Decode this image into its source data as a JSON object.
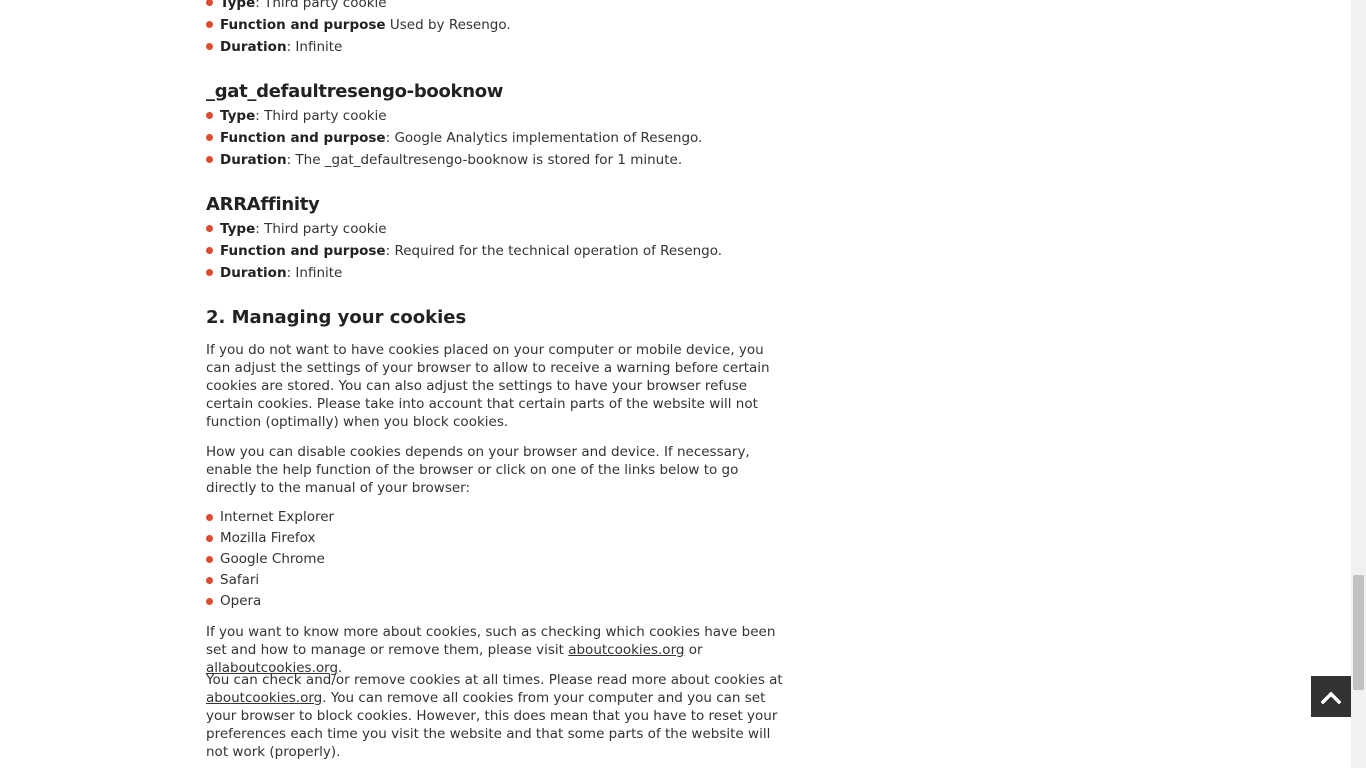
{
  "top_partial": {
    "items": [
      {
        "label": "Type",
        "sep": ": ",
        "text": "Third party cookie"
      },
      {
        "label": "Function and purpose",
        "sep": " ",
        "text": "Used by Resengo."
      },
      {
        "label": "Duration",
        "sep": ": ",
        "text": "Infinite"
      }
    ]
  },
  "gat": {
    "title": "_gat_defaultresengo-booknow",
    "items": [
      {
        "label": "Type",
        "sep": ": ",
        "text": "Third party cookie"
      },
      {
        "label": "Function and purpose",
        "sep": ": ",
        "text": "Google Analytics implementation of Resengo."
      },
      {
        "label": "Duration",
        "sep": ": ",
        "text": "The _gat_defaultresengo-booknow is stored for 1 minute."
      }
    ]
  },
  "arr": {
    "title": "ARRAffinity",
    "items": [
      {
        "label": "Type",
        "sep": ": ",
        "text": "Third party cookie"
      },
      {
        "label": "Function and purpose",
        "sep": ": ",
        "text": "Required for the technical operation of Resengo."
      },
      {
        "label": "Duration",
        "sep": ": ",
        "text": "Infinite"
      }
    ]
  },
  "managing": {
    "title": "2. Managing your cookies",
    "para1": "If you do not want to have cookies placed on your computer or mobile device, you can adjust the settings of your browser to allow to receive a warning before certain cookies are stored. You can also adjust the settings to have your browser refuse certain cookies. Please take into account that certain parts of the website will not function (optimally) when you block cookies.",
    "para2": "How you can disable cookies depends on your browser and device. If necessary, enable the help function of the browser or click on one of the links below to go directly to the manual of your browser:",
    "browsers": [
      "Internet Explorer",
      "Mozilla Firefox",
      "Google Chrome",
      "Safari",
      "Opera"
    ],
    "para3_before": "If you want to know more about cookies, such as checking which cookies have been set and how to manage or remove them, please visit ",
    "link1": "aboutcookies.org",
    "para3_mid": " or ",
    "link2": "allaboutcookies.org",
    "para3_after": ".",
    "para4_before": "You can check and/or remove cookies at all times. Please read more about cookies at ",
    "link3": "aboutcookies.org",
    "para4_after": ". You can remove all cookies from your computer and you can set your browser to block cookies. However, this does mean that you have to reset your preferences each time you visit the website and that some parts of the website will not work (properly)."
  },
  "icons": {
    "scroll_top": "chevron-up-icon",
    "bullet": "bullet-dot-icon"
  },
  "colors": {
    "bullet": "#e04a2f",
    "scroll_top_bg": "#333333"
  }
}
